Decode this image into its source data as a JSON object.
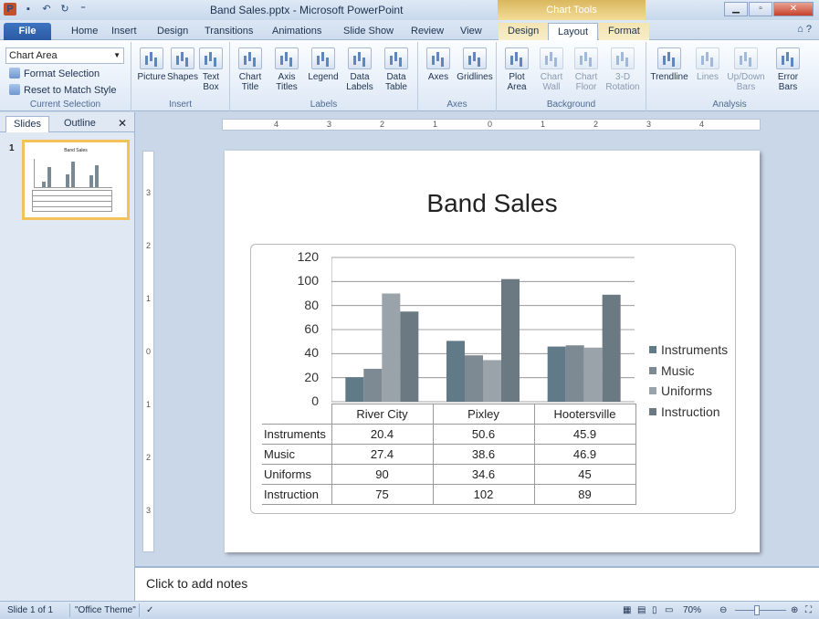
{
  "window": {
    "title": "Band Sales.pptx - Microsoft PowerPoint",
    "context_band": "Chart Tools"
  },
  "tabs": [
    "File",
    "Home",
    "Insert",
    "Design",
    "Transitions",
    "Animations",
    "Slide Show",
    "Review",
    "View",
    "Design",
    "Layout",
    "Format"
  ],
  "ribbon": {
    "current_selection": {
      "selected_element": "Chart Area",
      "format_selection": "Format Selection",
      "reset": "Reset to Match Style",
      "label": "Current Selection"
    },
    "insert": {
      "picture": "Picture",
      "shapes": "Shapes",
      "text_box": "Text Box",
      "label": "Insert"
    },
    "labels": {
      "chart_title": "Chart Title",
      "axis_titles": "Axis Titles",
      "legend": "Legend",
      "data_labels": "Data Labels",
      "data_table": "Data Table",
      "label": "Labels"
    },
    "axes": {
      "axes": "Axes",
      "gridlines": "Gridlines",
      "label": "Axes"
    },
    "background": {
      "plot_area": "Plot Area",
      "chart_wall": "Chart Wall",
      "chart_floor": "Chart Floor",
      "rotation": "3-D Rotation",
      "label": "Background"
    },
    "analysis": {
      "trendline": "Trendline",
      "lines": "Lines",
      "updown": "Up/Down Bars",
      "error": "Error Bars",
      "label": "Analysis"
    }
  },
  "left_pane": {
    "tab_slides": "Slides",
    "tab_outline": "Outline",
    "slide_number": "1",
    "thumb_title": "Band Sales"
  },
  "ruler": {
    "h": [
      "4",
      "3",
      "2",
      "1",
      "0",
      "1",
      "2",
      "3",
      "4"
    ],
    "v": [
      "3",
      "2",
      "1",
      "0",
      "1",
      "2",
      "3"
    ]
  },
  "slide": {
    "title": "Band Sales"
  },
  "notes": {
    "placeholder": "Click to add notes"
  },
  "status": {
    "slide": "Slide 1 of 1",
    "theme": "\"Office Theme\"",
    "zoom": "70%"
  },
  "chart_data": {
    "type": "bar",
    "title": "Band Sales",
    "categories": [
      "River City",
      "Pixley",
      "Hootersville"
    ],
    "series": [
      {
        "name": "Instruments",
        "values": [
          20.4,
          50.6,
          45.9
        ],
        "color": "#607b87"
      },
      {
        "name": "Music",
        "values": [
          27.4,
          38.6,
          46.9
        ],
        "color": "#7e8a93"
      },
      {
        "name": "Uniforms",
        "values": [
          90,
          34.6,
          45
        ],
        "color": "#99a3a9"
      },
      {
        "name": "Instruction",
        "values": [
          75,
          102,
          89
        ],
        "color": "#6b7a82"
      }
    ],
    "ylim": [
      0,
      120
    ],
    "yticks": [
      "0",
      "20",
      "40",
      "60",
      "80",
      "100",
      "120"
    ],
    "gridlines": true,
    "legend": "right",
    "data_table": true
  }
}
